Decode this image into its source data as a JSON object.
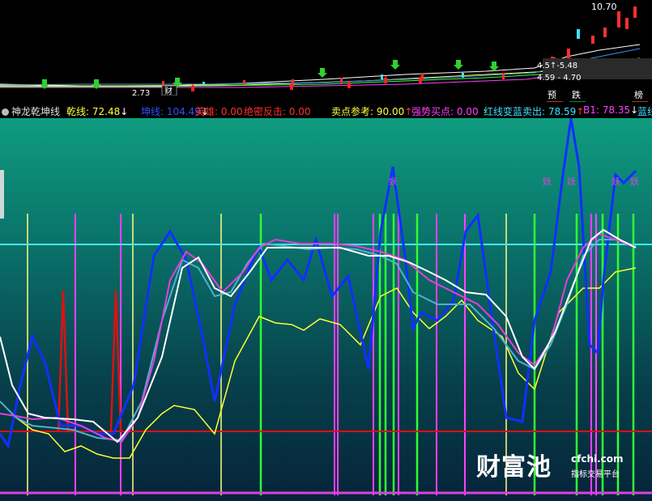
{
  "price_chart": {
    "high_label": "10.70",
    "low_label": "2.73",
    "range_label_1": "4.5↑-5.48",
    "range_label_2": "4.59 - 4.70",
    "tag_cai": "财",
    "tag_yu": "预",
    "tag_die": "跌",
    "tag_bang": "榜"
  },
  "indicator_bar": {
    "name": "神龙乾坤线",
    "items": [
      {
        "label": "乾线: 72.48",
        "arrow": "↓",
        "color": "#ffff40"
      },
      {
        "label": "坤线: 104.49",
        "arrow": "↓",
        "color": "#3050ff"
      },
      {
        "label": "英雄: 0.00",
        "arrow": "",
        "color": "#ff3030"
      },
      {
        "label": "绝密反击: 0.00",
        "arrow": "",
        "color": "#ff3030"
      },
      {
        "label": "卖点参考: 90.00",
        "arrow": "↑",
        "color": "#ffff40"
      },
      {
        "label": "强势买点: 0.00",
        "arrow": "",
        "color": "#ff40ff"
      },
      {
        "label": "红线变蓝卖出: 78.59",
        "arrow": "↑",
        "color": "#40e0ff"
      },
      {
        "label": "B1: 78.35",
        "arrow": "↓",
        "color": "#ff40ff"
      },
      {
        "label": "蓝线",
        "arrow": "",
        "color": "#40e0ff"
      }
    ]
  },
  "lower_chart": {
    "yao_label": "妖",
    "colors": {
      "cyan_line": "#40e8e8",
      "red_line": "#e01010",
      "magenta_line": "#e040e0",
      "blue_line": "#1030ff",
      "white_line": "#ffffff",
      "yellow_line": "#ffff30",
      "green_bar": "#30ff30",
      "magenta_bar": "#ff40ff",
      "red_spike": "#e01010",
      "lightblue_line": "#4fb0d0"
    }
  },
  "watermark": {
    "brand": "财富池",
    "url": "cfchi.com",
    "slogan": "指标交易平台"
  }
}
